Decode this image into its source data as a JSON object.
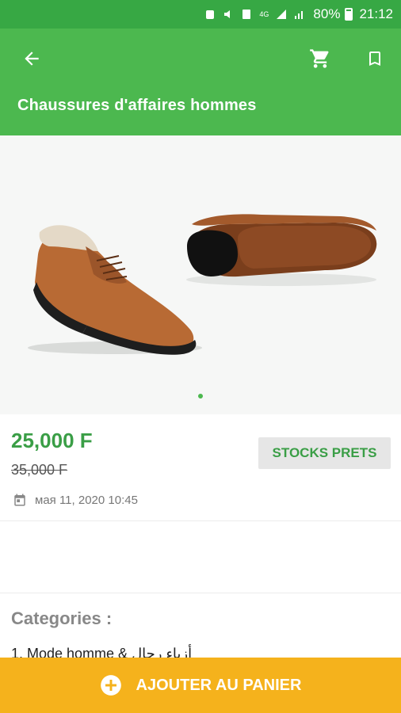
{
  "status_bar": {
    "battery_percent": "80%",
    "time": "21:12",
    "network": "4G"
  },
  "app_bar": {
    "title": "Chaussures d'affaires hommes",
    "back_icon": "arrow-left",
    "cart_icon": "shopping-cart",
    "bookmark_icon": "bookmark"
  },
  "gallery": {
    "current_index": 0,
    "total_images": 1
  },
  "product": {
    "price": "25,000 F",
    "old_price": "35,000 F",
    "stock_label": "STOCKS PRETS",
    "date": "мая 11, 2020 10:45"
  },
  "categories": {
    "title": "Categories :",
    "items": [
      "1. Mode homme & أزياء رجال"
    ]
  },
  "cta": {
    "label": "AJOUTER AU PANIER"
  },
  "colors": {
    "primary": "#4cb84f",
    "status_bar": "#37a844",
    "price": "#3a9e46",
    "cta": "#f5b21c"
  }
}
